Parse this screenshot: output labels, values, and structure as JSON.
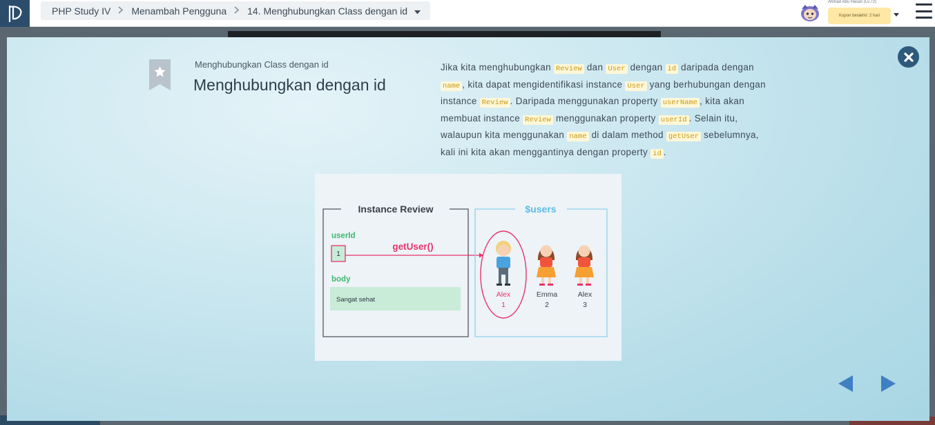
{
  "topbar": {
    "breadcrumb": [
      "PHP Study IV",
      "Menambah Pengguna",
      "14. Menghubungkan Class dengan id"
    ],
    "user_name": "Ahmad Abu Hasan (Lv.72)",
    "coupon_text": "Kupon berakhir: 2 hari"
  },
  "slide": {
    "subtitle": "Menghubungkan Class dengan id",
    "title": "Menghubungkan dengan id",
    "description": [
      {
        "t": "text",
        "v": "Jika kita menghubungkan "
      },
      {
        "t": "code",
        "v": "Review"
      },
      {
        "t": "text",
        "v": " dan "
      },
      {
        "t": "code",
        "v": "User"
      },
      {
        "t": "text",
        "v": " dengan "
      },
      {
        "t": "code",
        "v": "id"
      },
      {
        "t": "text",
        "v": " daripada dengan "
      },
      {
        "t": "code",
        "v": "name"
      },
      {
        "t": "text",
        "v": ", kita dapat mengidentifikasi instance "
      },
      {
        "t": "code",
        "v": "User"
      },
      {
        "t": "text",
        "v": " yang berhubungan dengan instance "
      },
      {
        "t": "code",
        "v": "Review"
      },
      {
        "t": "text",
        "v": ". Daripada menggunakan property "
      },
      {
        "t": "code",
        "v": "userName"
      },
      {
        "t": "text",
        "v": ", kita akan membuat instance "
      },
      {
        "t": "code",
        "v": "Review"
      },
      {
        "t": "text",
        "v": " menggunakan property "
      },
      {
        "t": "code",
        "v": "userId"
      },
      {
        "t": "text",
        "v": ". Selain itu, walaupun kita menggunakan "
      },
      {
        "t": "code",
        "v": "name"
      },
      {
        "t": "text",
        "v": " di dalam method "
      },
      {
        "t": "code",
        "v": "getUser"
      },
      {
        "t": "text",
        "v": " sebelumnya, kali ini kita akan menggantinya dengan property "
      },
      {
        "t": "code",
        "v": "id"
      },
      {
        "t": "text",
        "v": "."
      }
    ]
  },
  "diagram": {
    "left_title": "Instance Review",
    "userid_label": "userId",
    "userid_value": "1",
    "method_label": "getUser()",
    "body_label": "body",
    "body_value": "Sangat sehat",
    "right_title": "$users",
    "users": [
      {
        "name": "Alex",
        "id": "1",
        "gender": "boy",
        "highlight": true
      },
      {
        "name": "Emma",
        "id": "2",
        "gender": "girl",
        "highlight": false
      },
      {
        "name": "Alex",
        "id": "3",
        "gender": "girl",
        "highlight": false
      }
    ]
  },
  "colors": {
    "accent_pink": "#e8336b",
    "label_green": "#3fba6e",
    "users_blue": "#5bbde6",
    "code_bg": "#fff7d7",
    "code_fg": "#c99a1a",
    "nav_blue": "#3f7fc4"
  }
}
